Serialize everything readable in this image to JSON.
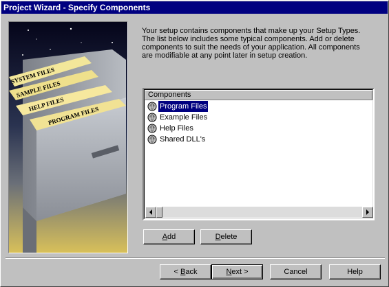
{
  "window": {
    "title": "Project Wizard - Specify Components"
  },
  "illustration": {
    "tabs": [
      "SYSTEM FILES",
      "SAMPLE FILES",
      "HELP FILES",
      "PROGRAM FILES"
    ]
  },
  "description": {
    "lines": [
      "Your setup contains components that make up your Setup Types.",
      "The list below includes some typical components.  Add or delete",
      "components to suit the needs of your application.  All components",
      "are modifiable at any point later in setup creation."
    ]
  },
  "components": {
    "header": "Components",
    "items": [
      {
        "label": "Program Files",
        "selected": true
      },
      {
        "label": "Example Files",
        "selected": false
      },
      {
        "label": "Help Files",
        "selected": false
      },
      {
        "label": "Shared DLL's",
        "selected": false
      }
    ]
  },
  "buttons": {
    "add": {
      "accel": "A",
      "rest": "dd"
    },
    "delete": {
      "accel": "D",
      "rest": "elete"
    },
    "back": {
      "pre": "< ",
      "accel": "B",
      "rest": "ack"
    },
    "next": {
      "accel": "N",
      "rest": "ext >"
    },
    "cancel": "Cancel",
    "help": "Help"
  },
  "colors": {
    "titlebar": "#000080",
    "face": "#c0c0c0",
    "selection": "#000080"
  }
}
